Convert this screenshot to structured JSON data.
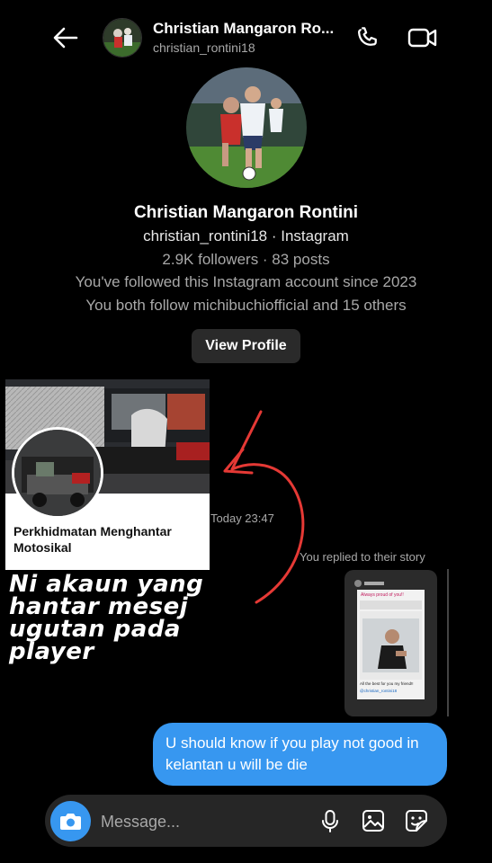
{
  "header": {
    "name": "Christian Mangaron Ro...",
    "username": "christian_rontini18",
    "icons": {
      "back": "arrow-left-icon",
      "call": "phone-icon",
      "video": "video-camera-icon"
    }
  },
  "profile": {
    "full_name": "Christian Mangaron Rontini",
    "handle_line": "christian_rontini18 · Instagram",
    "stats_line": "2.9K followers · 83 posts",
    "follow_since": "You've followed this Instagram account since 2023",
    "mutual_line": "You both follow michibuchiofficial and 15 others",
    "view_profile_label": "View Profile"
  },
  "shared_card": {
    "title": "Perkhidmatan Menghantar Motosikal"
  },
  "annotation": {
    "text_lines": [
      "Ni akaun yang",
      "hantar mesej",
      "ugutan pada",
      "player"
    ],
    "arrow_color": "#e53935"
  },
  "chat": {
    "timestamp": "Today 23:47",
    "replied_label": "You replied to their story",
    "story_texts": {
      "top_caption": "Always proud of you!!",
      "bottom_caption": "All the best for you my friend!!",
      "tag": "@christian_rontini18"
    },
    "message": "U should know if you play not good in kelantan u will be die",
    "bubble_color": "#3797f0"
  },
  "composer": {
    "placeholder": "Message...",
    "icons": {
      "camera": "camera-icon",
      "mic": "microphone-icon",
      "gallery": "gallery-icon",
      "sticker": "sticker-icon"
    }
  }
}
